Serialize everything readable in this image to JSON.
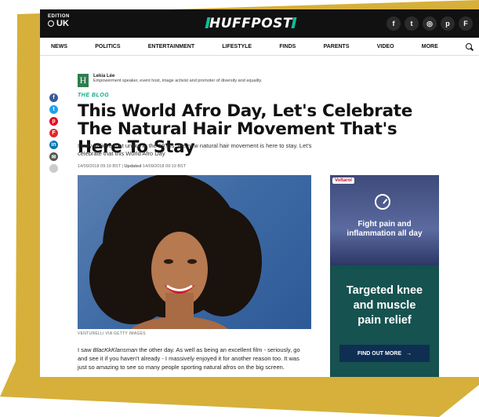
{
  "colors": {
    "accent": "#0aa98a",
    "backdrop": "#d6b03a",
    "header": "#111111"
  },
  "header": {
    "edition_small": "EDITION",
    "edition": "UK",
    "logo": "HUFFPOST",
    "socials": [
      {
        "icon": "facebook-icon",
        "glyph": "f"
      },
      {
        "icon": "twitter-icon",
        "glyph": "t"
      },
      {
        "icon": "instagram-icon",
        "glyph": "◎"
      },
      {
        "icon": "pinterest-icon",
        "glyph": "p"
      },
      {
        "icon": "flipboard-icon",
        "glyph": "F"
      }
    ]
  },
  "nav": [
    "NEWS",
    "POLITICS",
    "ENTERTAINMENT",
    "LIFESTYLE",
    "FINDS",
    "PARENTS",
    "VIDEO",
    "MORE"
  ],
  "author": {
    "initial": "H",
    "name": "Lekia Lée",
    "bio": "Empowerment speaker, event host, image activist and promoter of diversity and equality."
  },
  "article": {
    "kicker": "THE BLOG",
    "title": "This World Afro Day, Let's Celebrate The Natural Hair Movement That's Here To Stay",
    "subtitle": "I truly believe that unlike in the 1970s, the new natural hair movement is here to stay. Let's celebrate that this World Afro Day",
    "published": "14/09/2018 09:19 BST",
    "updated_label": "Updated",
    "updated": "14/09/2018 09:19 BST",
    "caption": "VENTURELLI VIA GETTY IMAGES",
    "body_pre": "I saw ",
    "body_film": "BlacKkKlansman",
    "body_post": " the other day. As well as being an excellent film - seriously, go and see it if you haven't already - I massively enjoyed it for another reason too. It was just so amazing to see so many people sporting natural afros on the big screen."
  },
  "share": [
    {
      "icon": "facebook-icon",
      "glyph": "f",
      "color": "#3b5998"
    },
    {
      "icon": "twitter-icon",
      "glyph": "t",
      "color": "#1da1f2"
    },
    {
      "icon": "pinterest-icon",
      "glyph": "p",
      "color": "#e60023"
    },
    {
      "icon": "flipboard-icon",
      "glyph": "F",
      "color": "#e12828"
    },
    {
      "icon": "linkedin-icon",
      "glyph": "in",
      "color": "#0077b5"
    },
    {
      "icon": "email-icon",
      "glyph": "✉",
      "color": "#555555"
    },
    {
      "icon": "comment-icon",
      "glyph": "",
      "color": "#cccccc"
    }
  ],
  "ad": {
    "brand": "Voltarol",
    "line1": "Fight pain and",
    "line2": "inflammation all day",
    "headline1": "Targeted knee",
    "headline2": "and muscle",
    "headline3": "pain relief",
    "cta": "FIND OUT MORE",
    "cta_arrow": "→"
  }
}
